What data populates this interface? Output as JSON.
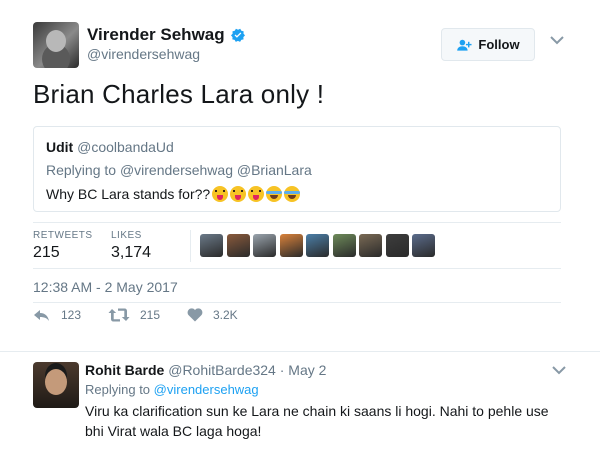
{
  "tweet": {
    "author_name": "Virender Sehwag",
    "author_handle": "@virendersehwag",
    "follow_label": "Follow",
    "text": "Brian Charles Lara only !",
    "quote": {
      "name": "Udit",
      "handle": "@coolbandaUd",
      "replying_prefix": "Replying to",
      "replying_handles": "@virendersehwag @BrianLara",
      "text": "Why BC Lara stands for??",
      "emojis": [
        "tongue-emoji",
        "tongue-emoji",
        "tongue-emoji",
        "joy-emoji",
        "joy-emoji"
      ]
    },
    "stats": {
      "retweets_label": "RETWEETS",
      "retweets_value": "215",
      "likes_label": "LIKES",
      "likes_value": "3,174"
    },
    "liker_avatar_colors": [
      "#6b7a89",
      "#8a5a3c",
      "#9aa4ad",
      "#d9823b",
      "#4b7fa8",
      "#6e8b5a",
      "#7a6a55",
      "#3d3d3d",
      "#5b6c8c"
    ],
    "timestamp": "12:38 AM - 2 May 2017",
    "actions": {
      "reply_count": "123",
      "retweet_count": "215",
      "like_count": "3.2K"
    }
  },
  "reply": {
    "name": "Rohit Barde",
    "handle": "@RohitBarde324",
    "date": "· May 2",
    "replying_prefix": "Replying to",
    "replying_handle": "@virendersehwag",
    "text": "Viru ka clarification sun ke Lara ne chain ki saans li hogi. Nahi to pehle use bhi Virat wala BC laga hoga!"
  },
  "colors": {
    "accent": "#1da1f2",
    "text": "#14171a",
    "muted": "#657786",
    "border": "#e1e8ed"
  }
}
